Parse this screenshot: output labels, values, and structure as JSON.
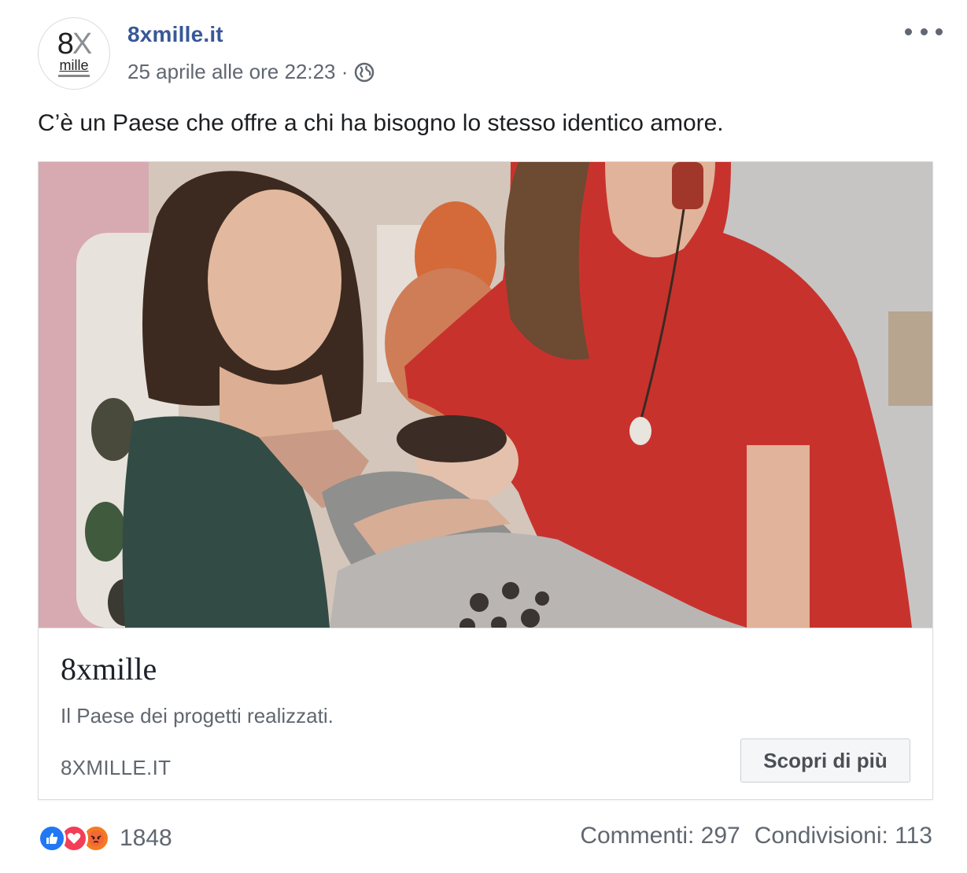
{
  "post": {
    "page_name": "8xmille.it",
    "timestamp": "25 aprile alle ore 22:23 ·",
    "message": "C’è un Paese che offre a chi ha bisogno lo stesso identico amore.",
    "avatar_logo": {
      "line1_a": "8",
      "line1_b": "X",
      "line2": "mille"
    }
  },
  "link_card": {
    "title": "8xmille",
    "description": "Il Paese dei progetti realizzati.",
    "domain": "8XMILLE.IT",
    "cta_label": "Scopri di più",
    "image_alt": "Two women, one breastfeeding a baby, in a home setting"
  },
  "footer": {
    "reactions": [
      "like-icon",
      "love-icon",
      "angry-icon"
    ],
    "reaction_count": "1848",
    "comments": "Commenti: 297",
    "shares": "Condivisioni: 113"
  },
  "colors": {
    "page_name": "#385898",
    "like": "#2078f4",
    "love": "#f33e58",
    "angry": "#f47b20"
  }
}
